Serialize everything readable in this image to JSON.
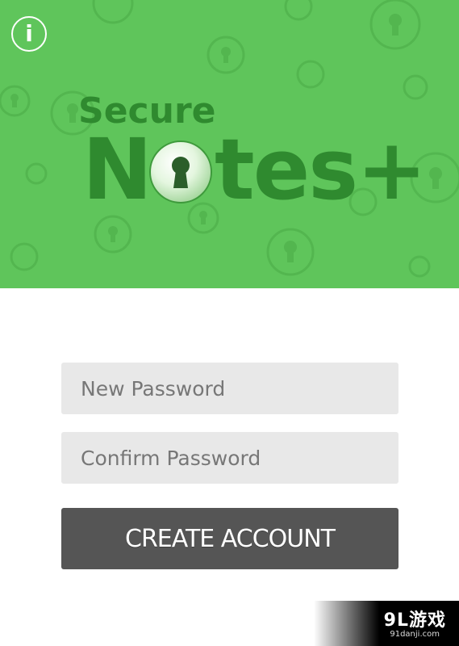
{
  "header": {
    "info_icon_glyph": "i",
    "logo": {
      "line1": "Secure",
      "line2_start": "N",
      "line2_end": "tes+"
    }
  },
  "form": {
    "new_password": {
      "value": "",
      "placeholder": "New Password"
    },
    "confirm_password": {
      "value": "",
      "placeholder": "Confirm Password"
    },
    "create_button_label": "CREATE ACCOUNT"
  },
  "watermark": {
    "text": "9L游戏",
    "site": "91danji.com"
  },
  "colors": {
    "header_green": "#5fc55b",
    "logo_green": "#2f8a2f",
    "input_bg": "#e8e8e8",
    "button_bg": "#555555"
  },
  "icons": {
    "info": "info-icon",
    "keyhole": "keyhole-icon",
    "background_pattern": "keyhole-pattern"
  }
}
